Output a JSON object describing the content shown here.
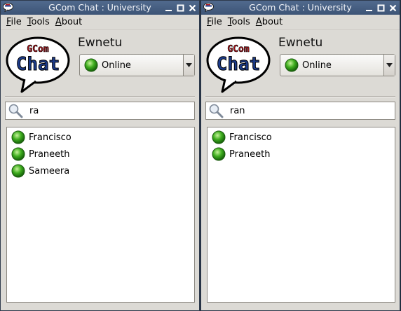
{
  "windows": [
    {
      "title": "GCom Chat : University",
      "menu": [
        {
          "accel": "F",
          "rest": "ile"
        },
        {
          "accel": "T",
          "rest": "ools"
        },
        {
          "accel": "A",
          "rest": "bout"
        }
      ],
      "logo": {
        "top": "GCom",
        "bottom": "Chat"
      },
      "username": "Ewnetu",
      "status": "Online",
      "search_value": "ra",
      "contacts": [
        "Francisco",
        "Praneeth",
        "Sameera"
      ]
    },
    {
      "title": "GCom Chat : University",
      "menu": [
        {
          "accel": "F",
          "rest": "ile"
        },
        {
          "accel": "T",
          "rest": "ools"
        },
        {
          "accel": "A",
          "rest": "bout"
        }
      ],
      "logo": {
        "top": "GCom",
        "bottom": "Chat"
      },
      "username": "Ewnetu",
      "status": "Online",
      "search_value": "ran",
      "contacts": [
        "Francisco",
        "Praneeth"
      ]
    }
  ],
  "colors": {
    "titlebar": "#516a8e",
    "online": "#3fae1f",
    "logo_red": "#b3141b",
    "logo_blue": "#1c3c8c"
  },
  "icons": {
    "app": "chat-bubble-icon",
    "minimize": "minimize-icon",
    "maximize": "maximize-icon",
    "close": "close-icon",
    "status": "online-dot-icon",
    "dropdown": "dropdown-arrow-icon",
    "search": "search-icon"
  }
}
